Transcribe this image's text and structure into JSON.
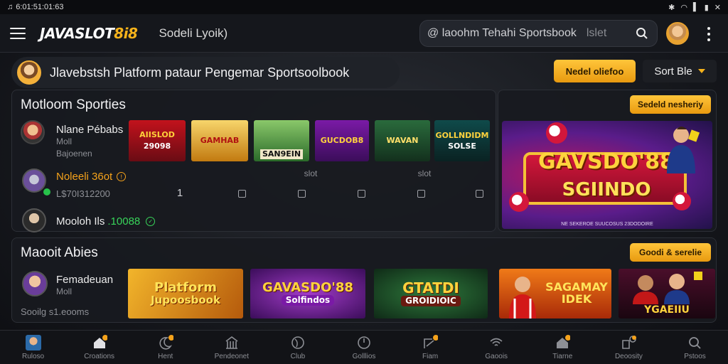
{
  "status_bar": {
    "time": "6:01:51:01:63"
  },
  "app_bar": {
    "logo_main": "JAVASLOT",
    "logo_accent": "8i8",
    "subtitle": "Sodeli Lyoik)",
    "search_text": "@ laoohm Tehahi Sportsbook",
    "search_sep": "lslet"
  },
  "banner": {
    "pill_text": "Jlavebstsh Platform pataur Pengemar Sportsoolbook",
    "newest_btn": "Nedel oliefoo",
    "sort_label": "Sort Ble"
  },
  "section1": {
    "title": "Motloom Sporties",
    "users": [
      {
        "name": "Nlane Pébabs",
        "meta1": "Moll",
        "meta2": "Bajoenen"
      },
      {
        "name": "Noleeli 36ot",
        "meta1": "L$70I312200"
      },
      {
        "name": "Mooloh Ils",
        "highlight": ".10088"
      }
    ],
    "games": [
      {
        "l1": "AIISLOD",
        "l2": "29098"
      },
      {
        "l1": "GAMHAB",
        "l2": ""
      },
      {
        "l1": "",
        "l2": "SAN9EIN"
      },
      {
        "l1": "GUCDOB8",
        "l2": ""
      },
      {
        "l1": "WAVAN",
        "l2": ""
      },
      {
        "l1": "GOLLNDIDM",
        "l2": "SOLSE"
      }
    ],
    "row2_cells": [
      "1",
      "slot",
      "slot"
    ],
    "right_btn": "Sedeld nesheriy",
    "feature": {
      "t1": "GAVSDO'88",
      "t2": "SGIINDO",
      "footer": "NE SEKEROE SUUCOSUS 23DODOIRE"
    }
  },
  "section2": {
    "title": "Maooit Abies",
    "right_btn": "Goodi & serelie",
    "user": {
      "name": "Femadeuan",
      "meta1": "Moll",
      "meta2": "Sooilg s1.eooms"
    },
    "cards": [
      {
        "l1": "Platform",
        "l2": "Jupoosbook"
      },
      {
        "l1": "GAVASDO'88",
        "l2": "Solfindos"
      },
      {
        "l1": "GTATDI",
        "l2": "GROIDIOIC"
      },
      {
        "l1": "SAGAMAY",
        "l2": "IDEK"
      },
      {
        "l1": "",
        "l2": "YGAEIIU"
      }
    ]
  },
  "bottom_nav": [
    {
      "label": "Ruloso",
      "icon": "avatar-icon"
    },
    {
      "label": "Croations",
      "icon": "home-icon",
      "badge": ""
    },
    {
      "label": "Hent",
      "icon": "moon-icon",
      "badge": ""
    },
    {
      "label": "Pendeonet",
      "icon": "building-icon"
    },
    {
      "label": "Club",
      "icon": "globe-icon"
    },
    {
      "label": "Golllios",
      "icon": "clock-icon"
    },
    {
      "label": "Fiam",
      "icon": "chart-icon",
      "badge": ""
    },
    {
      "label": "Gaoois",
      "icon": "wifi-icon"
    },
    {
      "label": "Tiarne",
      "icon": "house-icon",
      "badge": ""
    },
    {
      "label": "Deoosity",
      "icon": "stats-icon",
      "badge": ""
    },
    {
      "label": "Pstoos",
      "icon": "search-icon"
    }
  ]
}
